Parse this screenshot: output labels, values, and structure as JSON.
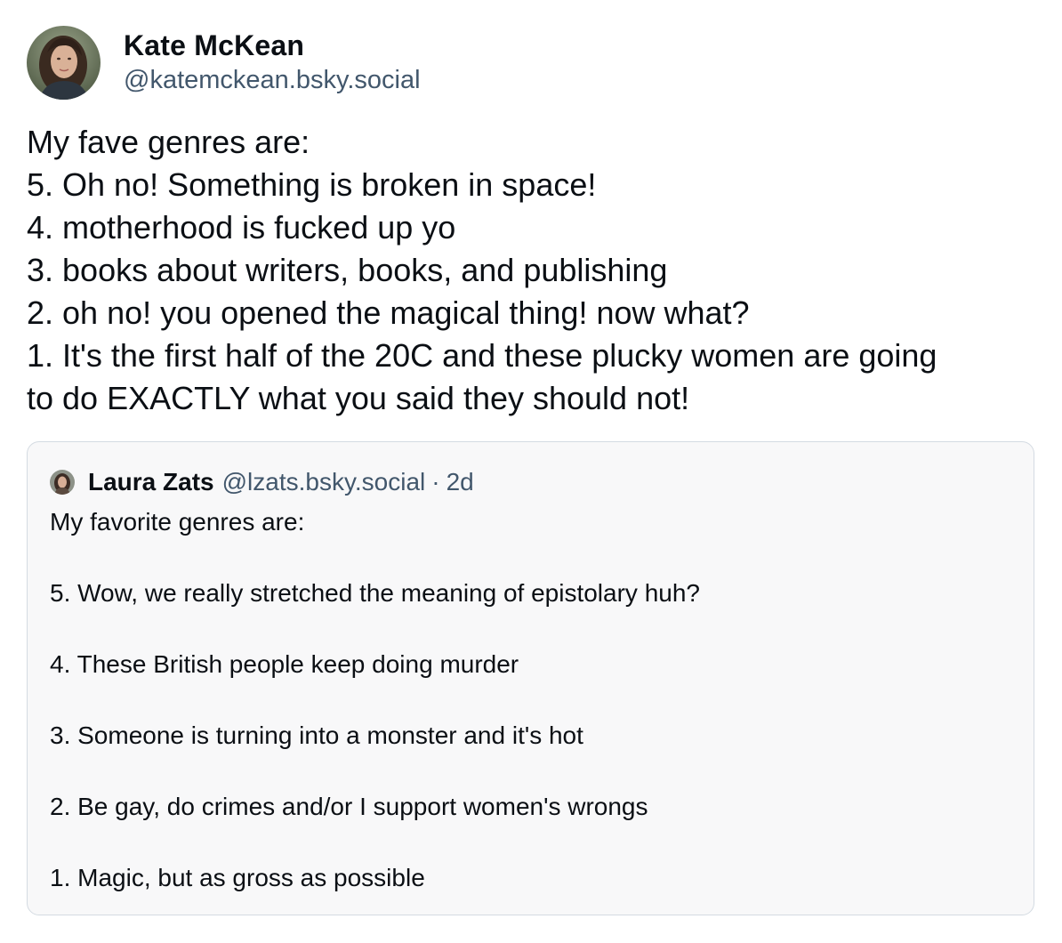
{
  "post": {
    "author": {
      "display_name": "Kate McKean",
      "handle": "@katemckean.bsky.social",
      "avatar_icon": "avatar-photo"
    },
    "text_lines": [
      "My fave genres are:",
      "5. Oh no! Something is broken in space!",
      "4. motherhood is fucked up yo",
      "3. books about writers, books, and publishing",
      "2. oh no! you opened the magical thing! now what?",
      "1. It's the first half of the 20C and these plucky women are going",
      "to do EXACTLY what you said they should not!"
    ]
  },
  "quote": {
    "author": {
      "display_name": "Laura Zats",
      "handle": "@lzats.bsky.social",
      "separator": "·",
      "timestamp": "2d",
      "avatar_icon": "avatar-photo"
    },
    "text_lines": [
      "My favorite genres are:",
      "",
      "5. Wow, we really stretched the meaning of epistolary huh?",
      "",
      "4. These British people keep doing murder",
      "",
      "3. Someone is turning into a monster and it's hot",
      "",
      "2. Be gay, do crimes and/or I support women's wrongs",
      "",
      "1. Magic, but as gross as possible"
    ]
  },
  "colors": {
    "text_primary": "#0b0f14",
    "text_secondary": "#42576c",
    "card_border": "#d4dbe2",
    "card_background": "#f8f8f9"
  }
}
